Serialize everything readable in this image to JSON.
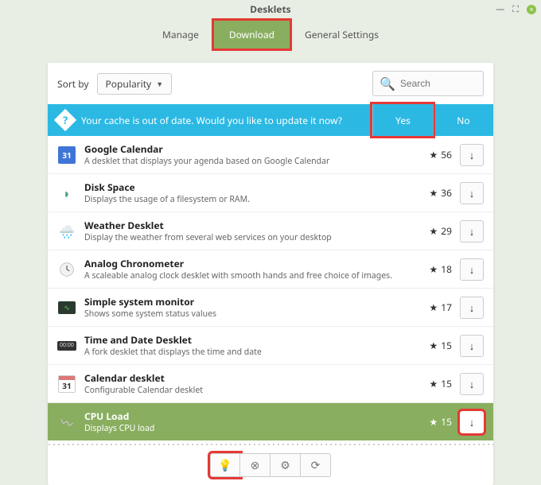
{
  "window": {
    "title": "Desklets"
  },
  "tabs": [
    {
      "label": "Manage"
    },
    {
      "label": "Download"
    },
    {
      "label": "General Settings"
    }
  ],
  "sort": {
    "label": "Sort by",
    "value": "Popularity"
  },
  "search": {
    "placeholder": "Search"
  },
  "banner": {
    "message": "Your cache is out of date. Would you like to update it now?",
    "yes": "Yes",
    "no": "No"
  },
  "items": [
    {
      "title": "Google Calendar",
      "desc": "A desklet that displays your agenda based on Google Calendar",
      "stars": 56,
      "icon_num": "31"
    },
    {
      "title": "Disk Space",
      "desc": "Displays the usage of a filesystem or RAM.",
      "stars": 36
    },
    {
      "title": "Weather Desklet",
      "desc": "Display the weather from several web services on your desktop",
      "stars": 29
    },
    {
      "title": "Analog Chronometer",
      "desc": "A scaleable analog clock desklet with smooth hands and free choice of images.",
      "stars": 18
    },
    {
      "title": "Simple system monitor",
      "desc": "Shows some system status values",
      "stars": 17
    },
    {
      "title": "Time and Date Desklet",
      "desc": "A fork desklet that displays the time and date",
      "stars": 15
    },
    {
      "title": "Calendar desklet",
      "desc": "Configurable Calendar desklet",
      "stars": 15,
      "icon_num": "31"
    },
    {
      "title": "CPU Load",
      "desc": "Displays CPU load",
      "stars": 15
    }
  ]
}
